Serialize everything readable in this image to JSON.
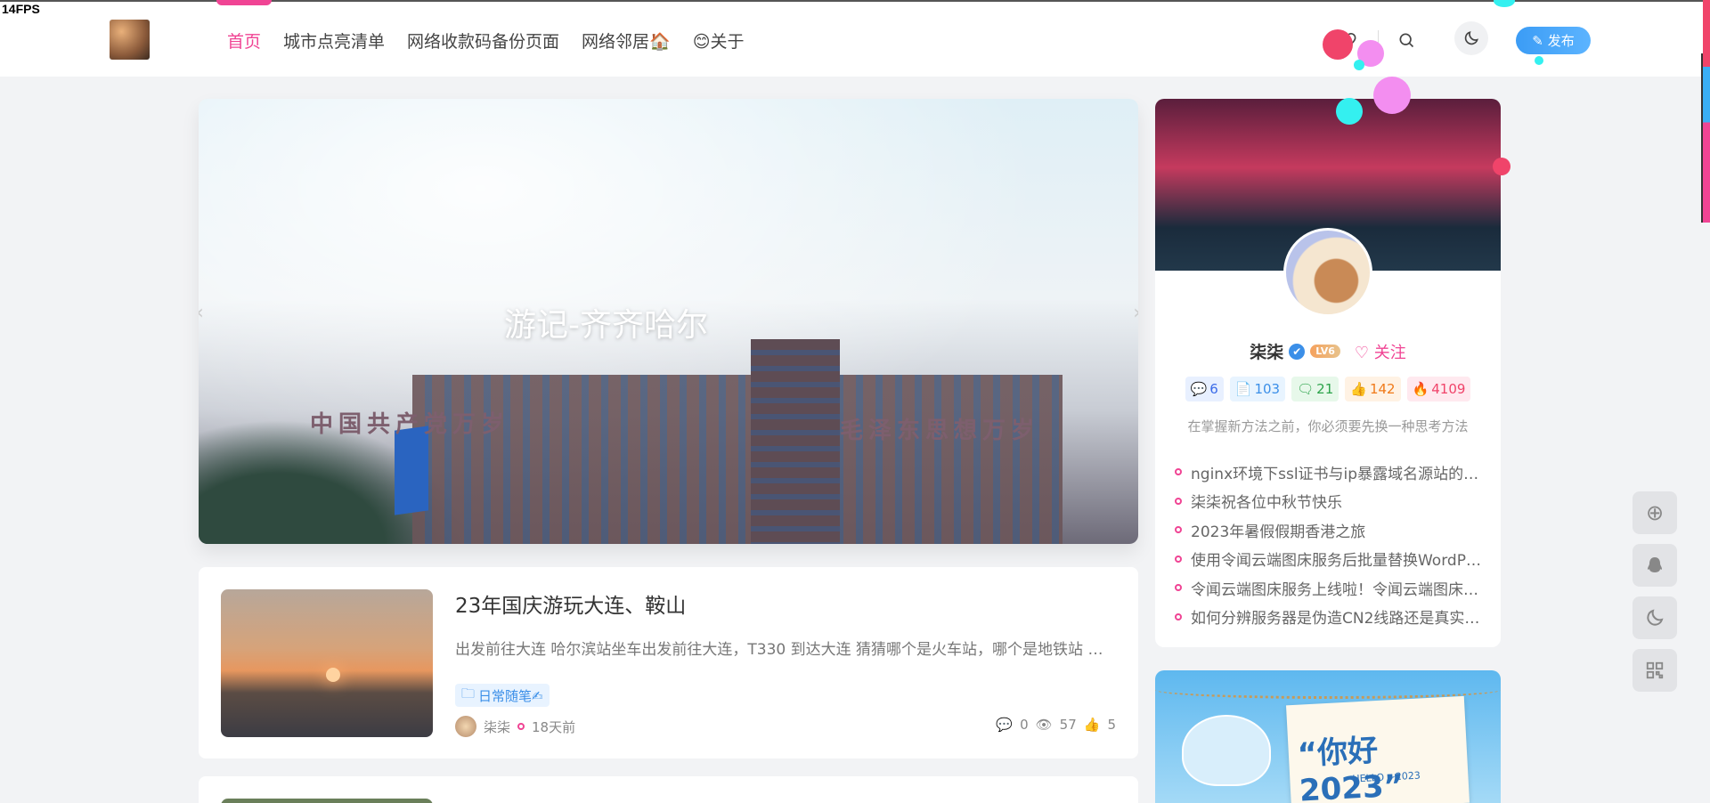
{
  "fps": "14FPS",
  "nav": {
    "items": [
      {
        "label": "首页",
        "active": true
      },
      {
        "label": "城市点亮清单"
      },
      {
        "label": "网络收款码备份页面"
      },
      {
        "label": "网络邻居🏠"
      },
      {
        "label": "😊关于"
      }
    ]
  },
  "header": {
    "publish_label": "发布",
    "icons": [
      "heart-icon",
      "search-icon",
      "moon-icon",
      "pencil-icon"
    ]
  },
  "banner": {
    "title": "游记-齐齐哈尔",
    "sign_left": "中国共产党万岁",
    "sign_right": "毛泽东思想万岁",
    "prev_arrow": "‹",
    "next_arrow": "›"
  },
  "posts": [
    {
      "title": "23年国庆游玩大连、鞍山",
      "excerpt": "出发前往大连 哈尔滨站坐车出发前往大连，T330 到达大连 猜猜哪个是火车站，哪个是地铁站 …",
      "category": "日常随笔✍",
      "author": "柒柒",
      "time": "18天前",
      "comments": "0",
      "views": "57",
      "likes": "5"
    }
  ],
  "user": {
    "name": "柒柒",
    "verified_icon": "✔",
    "level": "LV6",
    "follow_label": "关注",
    "stats": [
      {
        "icon": "comment-icon",
        "value": "6"
      },
      {
        "icon": "article-icon",
        "value": "103"
      },
      {
        "icon": "message-icon",
        "value": "21"
      },
      {
        "icon": "like-icon",
        "value": "142"
      },
      {
        "icon": "fire-icon",
        "value": "4109"
      }
    ],
    "motto": "在掌握新方法之前，你必须要先换一种思考方法",
    "recent": [
      "nginx环境下ssl证书与ip暴露域名源站的…",
      "柒柒祝各位中秋节快乐",
      "2023年暑假假期香港之旅",
      "使用令闻云端图床服务后批量替换WordP…",
      "令闻云端图床服务上线啦！令闻云端图床…",
      "如何分辨服务器是伪造CN2线路还是真实…"
    ]
  },
  "promo": {
    "title": "“你好2023”",
    "sub": "HELLO ~2023"
  },
  "tools": [
    "plus-circle-icon",
    "qq-icon",
    "moon-icon",
    "qrcode-icon"
  ],
  "colors": {
    "accent": "#f04494",
    "primary": "#3b8fe8"
  }
}
